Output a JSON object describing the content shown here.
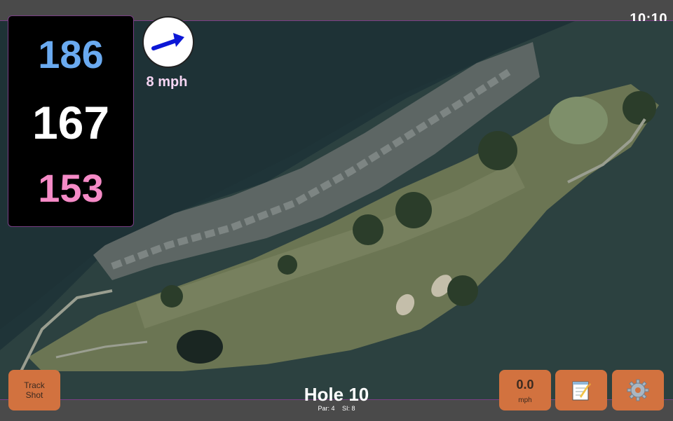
{
  "status": {
    "time": "10:10"
  },
  "distances": {
    "back": "186",
    "middle": "167",
    "front": "153"
  },
  "wind": {
    "speed": "8 mph",
    "icon": "wind-direction-arrow-icon"
  },
  "actions": {
    "track_shot": "Track Shot",
    "speed_value": "0.0",
    "speed_unit": "mph",
    "notes_icon": "notepad-icon",
    "settings_icon": "gear-icon"
  },
  "hole": {
    "title": "Hole 10",
    "par": "Par: 4",
    "si": "SI: 8"
  },
  "colors": {
    "back_distance": "#6aaaf0",
    "middle_distance": "#ffffff",
    "front_distance": "#f58ac6",
    "button": "#d2723f",
    "accent_border": "#7a3f86"
  }
}
